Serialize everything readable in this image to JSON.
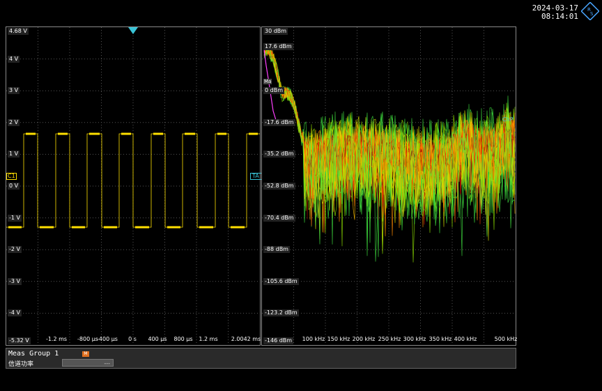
{
  "datetime": {
    "date": "2024-03-17",
    "time": "08:14:01"
  },
  "left_diagram": {
    "y_labels": [
      "4.68 V",
      "4 V",
      "3 V",
      "2 V",
      "1 V",
      "0 V",
      "-1 V",
      "-2 V",
      "-3 V",
      "-4 V",
      "-5.32 V"
    ],
    "x_labels": [
      "-1.2 ms",
      "-800 µs",
      "-400 µs",
      "0 s",
      "400 µs",
      "800 µs",
      "1.2 ms",
      "2.0042 ms"
    ],
    "channel_marker": "C1",
    "trigger_marker": "TA",
    "trace_color": "#ffe000"
  },
  "right_diagram": {
    "y_labels": [
      "30 dBm",
      "17.6 dBm",
      "0 dBm",
      "-17.6 dBm",
      "-35.2 dBm",
      "-52.8 dBm",
      "-70.4 dBm",
      "-88 dBm",
      "-105.6 dBm",
      "-123.2 dBm",
      "-146 dBm"
    ],
    "x_labels": [
      "100 kHz",
      "150 kHz",
      "200 kHz",
      "250 kHz",
      "300 kHz",
      "350 kHz",
      "400 kHz",
      "500 kHz"
    ],
    "channel_power_marker": "ChP",
    "marker_label": "Ma"
  },
  "meas": {
    "title": "Meas Group 1",
    "badge": "M",
    "row_label": "信道功率",
    "row_value": "---"
  }
}
